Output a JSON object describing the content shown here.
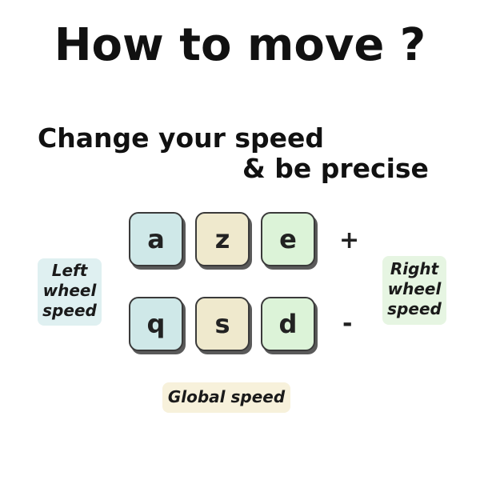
{
  "title": "How to move ?",
  "subtitle": {
    "line1": "Change your speed",
    "line2": "& be precise"
  },
  "keys": {
    "top_row": [
      "a",
      "z",
      "e"
    ],
    "bottom_row": [
      "q",
      "s",
      "d"
    ]
  },
  "signs": {
    "plus": "+",
    "minus": "-"
  },
  "labels": {
    "left": [
      "Left",
      "wheel",
      "speed"
    ],
    "right": [
      "Right",
      "wheel",
      "speed"
    ],
    "global": "Global speed"
  },
  "colors": {
    "left_key": "#cfe8e8",
    "middle_key": "#efe9cd",
    "right_key": "#dcf3d8",
    "left_label_bg": "#dff0f1",
    "right_label_bg": "#e6f5e2",
    "global_label_bg": "#f7f1db"
  }
}
